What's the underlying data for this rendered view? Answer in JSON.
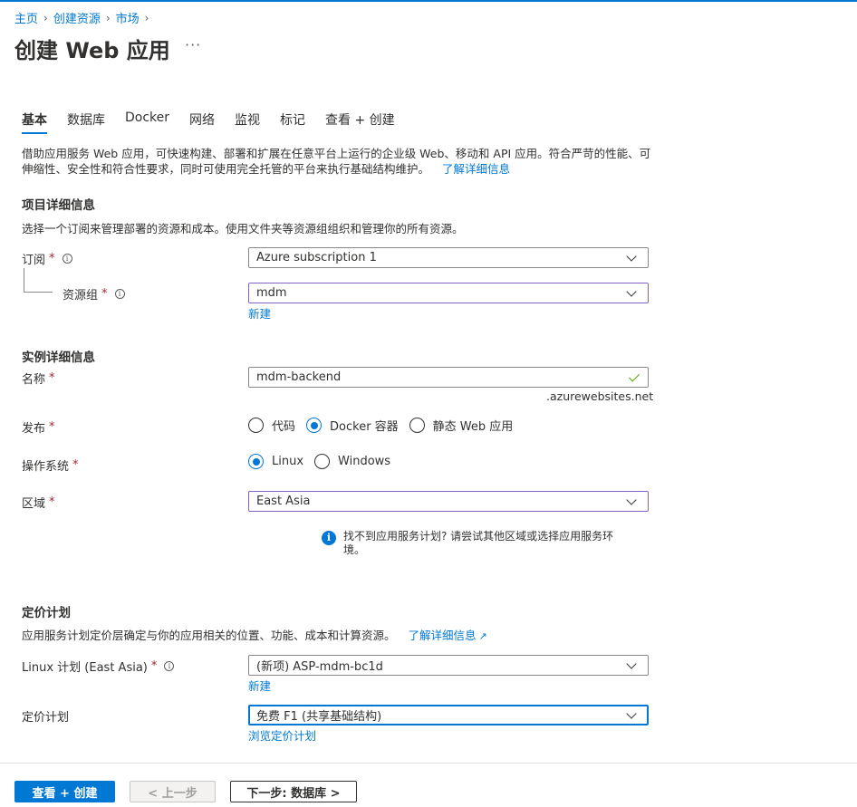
{
  "breadcrumb": [
    "主页",
    "创建资源",
    "市场"
  ],
  "page_title": "创建 Web 应用",
  "more_label": "···",
  "tabs": [
    "基本",
    "数据库",
    "Docker",
    "网络",
    "监视",
    "标记",
    "查看 + 创建"
  ],
  "description": {
    "text": "借助应用服务 Web 应用，可快速构建、部署和扩展在任意平台上运行的企业级 Web、移动和 API 应用。符合严苛的性能、可伸缩性、安全性和符合性要求，同时可使用完全托管的平台来执行基础结构维护。",
    "link": "了解详细信息"
  },
  "project": {
    "heading": "项目详细信息",
    "subtext": "选择一个订阅来管理部署的资源和成本。使用文件夹等资源组组织和管理你的所有资源。",
    "subscription_label": "订阅",
    "subscription_value": "Azure subscription 1",
    "resource_group_label": "资源组",
    "resource_group_value": "mdm",
    "new_link": "新建"
  },
  "instance": {
    "heading": "实例详细信息",
    "name_label": "名称",
    "name_value": "mdm-backend",
    "domain_suffix": ".azurewebsites.net",
    "publish_label": "发布",
    "publish_options": [
      "代码",
      "Docker 容器",
      "静态 Web 应用"
    ],
    "publish_selected": "Docker 容器",
    "os_label": "操作系统",
    "os_options": [
      "Linux",
      "Windows"
    ],
    "os_selected": "Linux",
    "region_label": "区域",
    "region_value": "East Asia",
    "info_text": "找不到应用服务计划? 请尝试其他区域或选择应用服务环境。"
  },
  "pricing": {
    "heading": "定价计划",
    "subtext": "应用服务计划定价层确定与你的应用相关的位置、功能、成本和计算资源。",
    "link": "了解详细信息",
    "plan_label": "Linux 计划 (East Asia)",
    "plan_value": "(新项) ASP-mdm-bc1d",
    "new_link": "新建",
    "tier_label": "定价计划",
    "tier_value": "免费 F1 (共享基础结构)",
    "browse_link": "浏览定价计划"
  },
  "footer": {
    "review_create": "查看 + 创建",
    "previous": "< 上一步",
    "next": "下一步: 数据库 >"
  },
  "required_mark": "*",
  "info_glyph": "i",
  "colors": {
    "accent": "#0078d4",
    "required": "#a4262c",
    "validation": "#57a300",
    "field_highlight": "#8661c5"
  }
}
